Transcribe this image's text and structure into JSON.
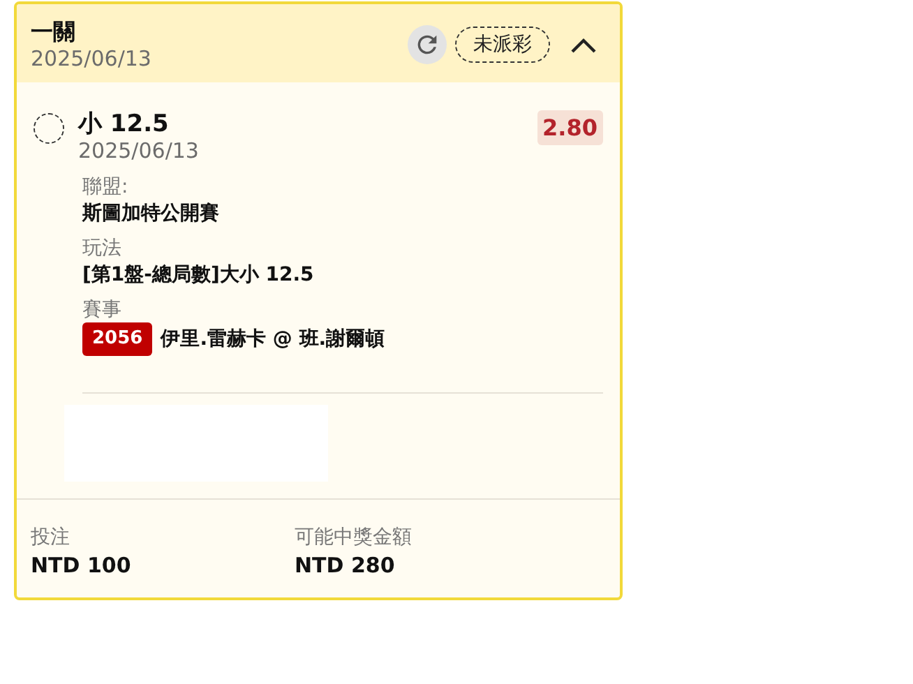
{
  "ticket": {
    "title": "一關",
    "date": "2025/06/13",
    "status": "未派彩",
    "expanded": true
  },
  "selections": [
    {
      "pick": "小 12.5",
      "date": "2025/06/13",
      "odds": "2.80",
      "settled": false,
      "fields": [
        {
          "label": "聯盟:",
          "value": "斯圖加特公開賽"
        },
        {
          "label": "玩法",
          "value": "[第1盤-總局數]大小 12.5"
        },
        {
          "label": "賽事",
          "code": "2056",
          "value": "伊里.雷赫卡 @ 班.謝爾頓"
        }
      ]
    }
  ],
  "summary": [
    {
      "label": "投注",
      "value": "NTD 100"
    },
    {
      "label": "可能中獎金額",
      "value": "NTD 280"
    }
  ]
}
